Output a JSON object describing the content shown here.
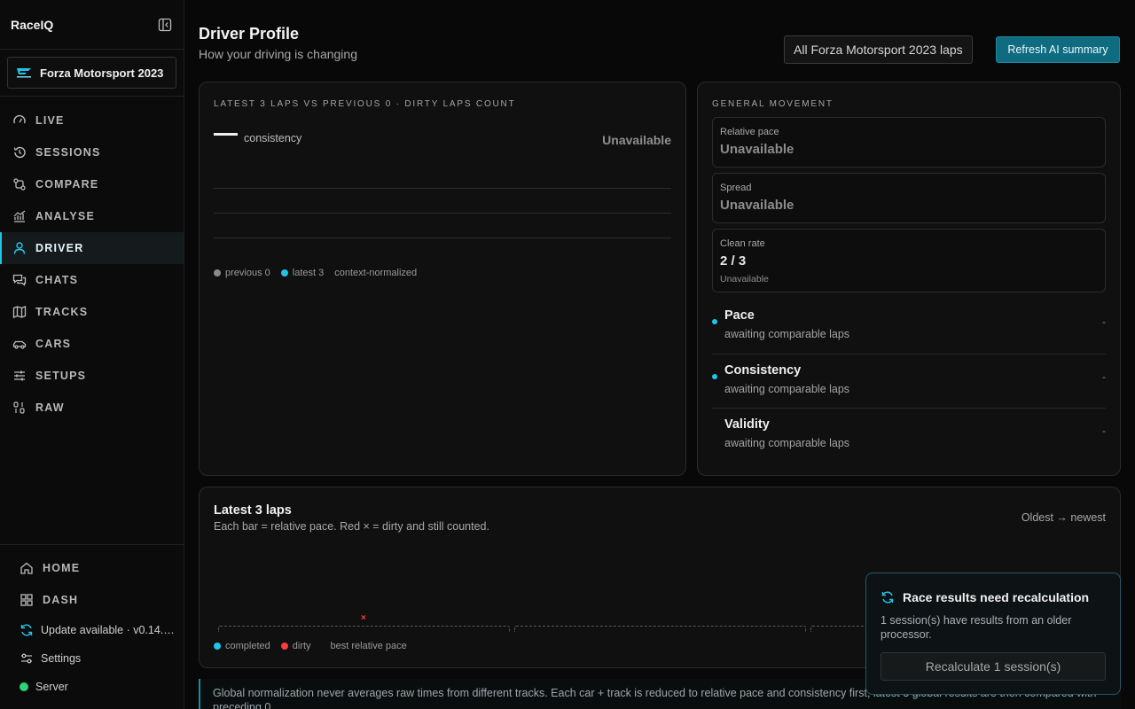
{
  "app": {
    "brand": "RaceIQ",
    "game": "Forza Motorsport 2023"
  },
  "sidebar": {
    "items": [
      {
        "label": "LIVE",
        "icon": "gauge-icon"
      },
      {
        "label": "SESSIONS",
        "icon": "history-icon"
      },
      {
        "label": "COMPARE",
        "icon": "compare-icon"
      },
      {
        "label": "ANALYSE",
        "icon": "analyse-chart-icon"
      },
      {
        "label": "DRIVER",
        "icon": "user-icon"
      },
      {
        "label": "CHATS",
        "icon": "chat-icon"
      },
      {
        "label": "TRACKS",
        "icon": "map-icon"
      },
      {
        "label": "CARS",
        "icon": "car-icon"
      },
      {
        "label": "SETUPS",
        "icon": "sliders-icon"
      },
      {
        "label": "RAW",
        "icon": "binary-icon"
      }
    ],
    "active": "DRIVER",
    "bottom": {
      "home": "HOME",
      "dash": "DASH",
      "update": "Update available · v0.14.…",
      "settings": "Settings",
      "server": "Server"
    }
  },
  "header": {
    "title": "Driver Profile",
    "subtitle": "How your driving is changing",
    "scope": "All Forza Motorsport 2023 laps",
    "refresh": "Refresh AI summary"
  },
  "trend": {
    "overline": "LATEST 3 LAPS VS PREVIOUS 0 · DIRTY LAPS COUNT",
    "metric_label": "consistency",
    "status": "Unavailable",
    "legend": {
      "previous": "previous 0",
      "latest": "latest 3",
      "note": "context-normalized"
    },
    "colors": {
      "previous": "#8a8a8a",
      "latest": "#22c4e6"
    }
  },
  "movement": {
    "overline": "GENERAL MOVEMENT",
    "stats": {
      "relative_pace": {
        "label": "Relative pace",
        "value": "Unavailable"
      },
      "spread": {
        "label": "Spread",
        "value": "Unavailable"
      },
      "clean_rate": {
        "label": "Clean rate",
        "value": "2 / 3",
        "note": "Unavailable"
      }
    },
    "rows": {
      "pace": {
        "title": "Pace",
        "sub": "awaiting comparable laps",
        "value": "-"
      },
      "consistency": {
        "title": "Consistency",
        "sub": "awaiting comparable laps",
        "value": "-"
      },
      "validity": {
        "title": "Validity",
        "sub": "awaiting comparable laps",
        "value": "-"
      }
    }
  },
  "laps": {
    "title": "Latest 3 laps",
    "subtitle": "Each bar = relative pace. Red × = dirty and still counted.",
    "order": "Oldest → newest",
    "dirty_mark": "×",
    "legend": {
      "completed": "completed",
      "dirty": "dirty",
      "best": "best relative pace"
    },
    "colors": {
      "completed": "#22c4e6",
      "dirty": "#ff3b3b"
    }
  },
  "footer": {
    "note": "Global normalization never averages raw times from different tracks. Each car + track is reduced to relative pace and consistency first; latest 3 global results are then compared with preceding 0."
  },
  "toast": {
    "title": "Race results need recalculation",
    "body": "1 session(s) have results from an older processor.",
    "button": "Recalculate 1 session(s)"
  }
}
